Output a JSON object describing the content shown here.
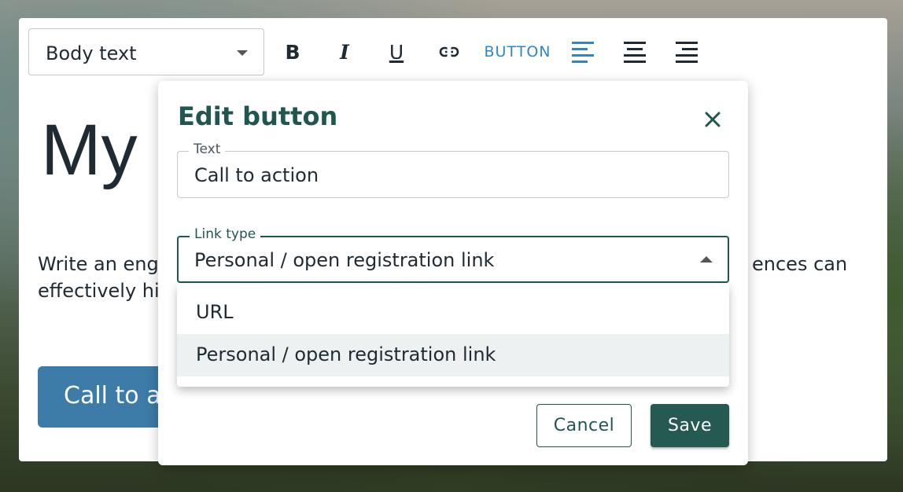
{
  "toolbar": {
    "style_select_value": "Body text",
    "bold_label": "B",
    "italic_label": "I",
    "underline_label": "U",
    "button_label": "BUTTON",
    "accent_color": "#2f86c7"
  },
  "document": {
    "heading": "My",
    "paragraph_left_line1": "Write an enga",
    "paragraph_left_line2": "effectively hig",
    "paragraph_right_line1": "ences can",
    "cta_label": "Call to a",
    "cta_color": "#3d7ba8"
  },
  "dialog": {
    "title": "Edit button",
    "text_field": {
      "legend": "Text",
      "value": "Call to action"
    },
    "link_type_field": {
      "legend": "Link type",
      "value": "Personal / open registration link"
    },
    "options": [
      "URL",
      "Personal / open registration link"
    ],
    "selected_option_index": 1,
    "cancel_label": "Cancel",
    "save_label": "Save",
    "primary_color": "#245a52"
  }
}
